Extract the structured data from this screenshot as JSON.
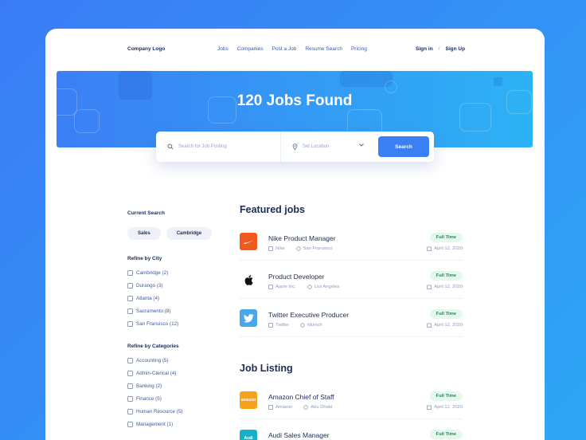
{
  "nav": {
    "logo": "Company Logo",
    "menu": [
      "Jobs",
      "Companies",
      "Post a Job",
      "Resume Search",
      "Pricing"
    ],
    "sign_in": "Sign in",
    "separator": "/",
    "sign_up": "Sign Up"
  },
  "hero": {
    "title": "120 Jobs Found"
  },
  "search": {
    "keyword_placeholder": "Search for Job Posting",
    "location_placeholder": "Set Location",
    "button_label": "Search"
  },
  "sidebar": {
    "current_search_heading": "Current Search",
    "chips": [
      "Sales",
      "Cambridge"
    ],
    "city_heading": "Refine by City",
    "cities": [
      "Cambridge (2)",
      "Durango (3)",
      "Atlanta (4)",
      "Sacramento (8)",
      "San Fransisco (12)"
    ],
    "categories_heading": "Refine by Categories",
    "categories": [
      "Accounting (5)",
      "Admin-Clerical (4)",
      "Banking (2)",
      "Finance (5)",
      "Human Resource (5)",
      "Management (1)"
    ]
  },
  "featured": {
    "heading": "Featured jobs",
    "jobs": [
      {
        "title": "Nike Product Manager",
        "company": "Nike",
        "location": "San Fransisco",
        "type": "Full Time",
        "date": "April 12, 2020",
        "logo_color": "#f05a1e",
        "logo_icon": "swoosh-icon"
      },
      {
        "title": "Product Developer",
        "company": "Apple Inc.",
        "location": "Los Angeles",
        "type": "Full Time",
        "date": "April 12, 2020",
        "logo_color": "#ffffff",
        "logo_icon": "apple-icon"
      },
      {
        "title": "Twitter Executive Producer",
        "company": "Twitter",
        "location": "Munich",
        "type": "Full Time",
        "date": "April 12, 2020",
        "logo_color": "#4aa8ea",
        "logo_icon": "bird-icon"
      }
    ]
  },
  "listing": {
    "heading": "Job Listing",
    "jobs": [
      {
        "title": "Amazon Chief of Staff",
        "company": "Amazon",
        "location": "Abu Dhabi",
        "type": "Full Time",
        "date": "April 12, 2020",
        "logo_color": "#f6a21a",
        "logo_text": "amazon"
      },
      {
        "title": "Audi Sales Manager",
        "company": "Audi",
        "location": "",
        "type": "Full Time",
        "date": "",
        "logo_color": "#17b0c9",
        "logo_text": "Audi"
      }
    ]
  },
  "colors": {
    "accent": "#3b7ff5",
    "badge_bg": "#e3f9ee",
    "badge_text": "#1c8c55",
    "heading": "#1d2c55"
  }
}
